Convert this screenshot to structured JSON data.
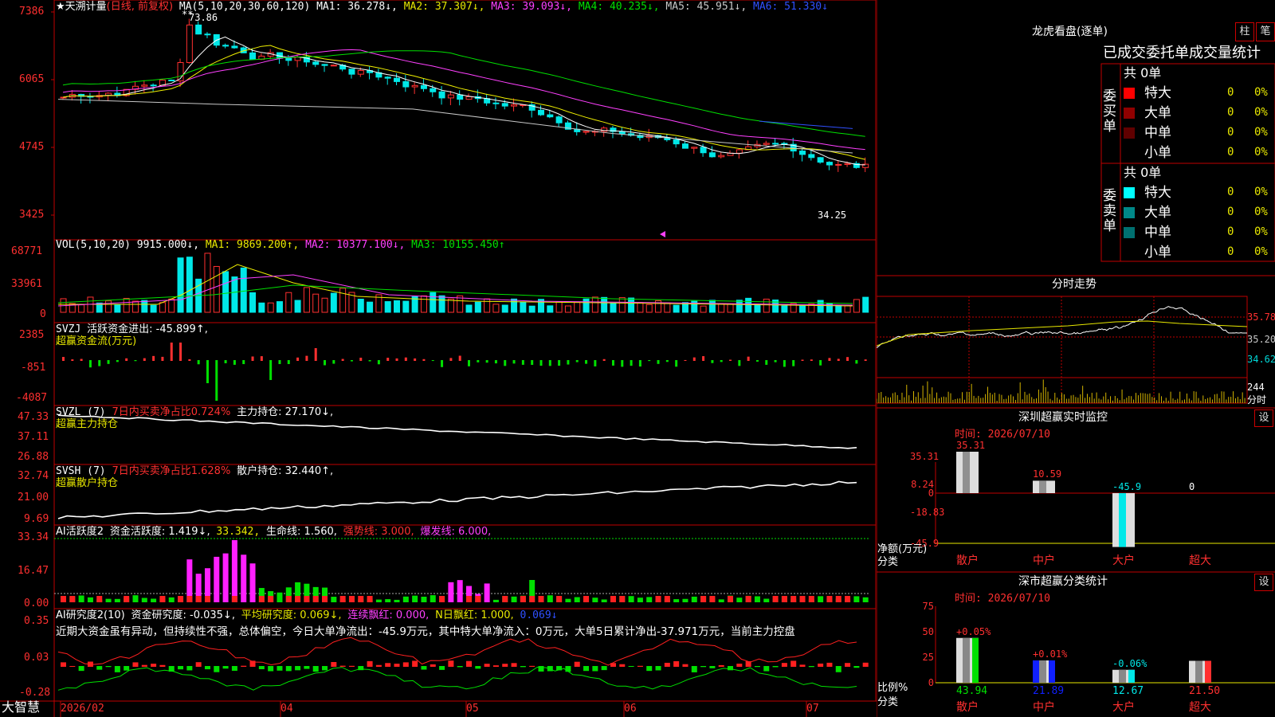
{
  "colors": {
    "up": "#ff3030",
    "down": "#00e8e8",
    "grid": "#c00000",
    "ma1": "#ffffff",
    "ma2": "#f0f000",
    "ma3": "#ff40ff",
    "ma4": "#00e000",
    "ma5": "#c8c8c8",
    "ma6": "#3050ff"
  },
  "main": {
    "title": "★天溯计量",
    "period": "(日线, 前复权)",
    "ma_header": "MA(5,10,20,30,60,120)",
    "ma1": "MA1: 36.278↓,",
    "ma2": "MA2: 37.307↓,",
    "ma3": "MA3: 39.093↓,",
    "ma4": "MA4: 40.235↓,",
    "ma5": "MA5: 45.951↓,",
    "ma6": "MA6: 51.330↓",
    "y_ticks": [
      "7386",
      "6065",
      "4745",
      "3425"
    ],
    "high_label": "73.86",
    "low_label": "34.25"
  },
  "vol": {
    "header": "VOL(5,10,20)",
    "value": "9915.000↓,",
    "ma1": "MA1: 9869.200↑,",
    "ma2": "MA2: 10377.100↓,",
    "ma3": "MA3: 10155.450↑",
    "y_ticks": [
      "68771",
      "33961",
      "0"
    ]
  },
  "svzj": {
    "header": "SVZJ",
    "label": "活跃资金进出: -45.899↑,",
    "sub": "超赢资金流(万元)",
    "y_ticks": [
      "2385",
      "-851",
      "-4087"
    ]
  },
  "svzl": {
    "header": "SVZL (7)",
    "a": "7日内买卖净占比0.724%",
    "b": "主力持仓: 27.170↓,",
    "sub": "超赢主力持仓",
    "y_ticks": [
      "47.33",
      "37.11",
      "26.88"
    ]
  },
  "svsh": {
    "header": "SVSH (7)",
    "a": "7日内买卖净占比1.628%",
    "b": "散户持仓: 32.440↑,",
    "sub": "超赢散户持仓",
    "y_ticks": [
      "32.74",
      "21.00",
      "9.69"
    ]
  },
  "ai2": {
    "header": "AI活跃度2",
    "a": "资金活跃度: 1.419↓,",
    "b": "33.342,",
    "c": "生命线: 1.560,",
    "d": "强势线: 3.000,",
    "e": "爆发线: 6.000,",
    "y_ticks": [
      "33.34",
      "16.47",
      "0.00"
    ]
  },
  "ai_r": {
    "header": "AI研究度2(10)",
    "a": "资金研究度: -0.035↓,",
    "b": "平均研究度: 0.069↓,",
    "c": "连续飘红: 0.000,",
    "d": "N日飘红: 1.000,",
    "e": "0.069↓",
    "comment": "近期大资金虽有异动，但持续性不强，总体偏空，今日大单净流出：-45.9万元，其中特大单净流入：0万元，大单5日累计净出-37.971万元，当前主力控盘",
    "y_ticks": [
      "0.35",
      "0.03",
      "-0.28"
    ]
  },
  "xaxis": {
    "brand": "大智慧",
    "labels": [
      "2026/02",
      "04",
      "05",
      "06",
      "07"
    ]
  },
  "dragon": {
    "title": "龙虎看盘(逐单)",
    "btn1": "柱",
    "btn2": "笔",
    "subtitle": "已成交委托单成交量统计",
    "buy": {
      "side": "委买单",
      "total": "共 0单",
      "rows": [
        {
          "name": "特大",
          "qty": "0",
          "pct": "0%",
          "color": "#ff0000"
        },
        {
          "name": "大单",
          "qty": "0",
          "pct": "0%",
          "color": "#900000"
        },
        {
          "name": "中单",
          "qty": "0",
          "pct": "0%",
          "color": "#600000"
        },
        {
          "name": "小单",
          "qty": "0",
          "pct": "0%",
          "color": ""
        }
      ]
    },
    "sell": {
      "side": "委卖单",
      "total": "共 0单",
      "rows": [
        {
          "name": "特大",
          "qty": "0",
          "pct": "0%",
          "color": "#00ffff"
        },
        {
          "name": "大单",
          "qty": "0",
          "pct": "0%",
          "color": "#008888"
        },
        {
          "name": "中单",
          "qty": "0",
          "pct": "0%",
          "color": "#007070"
        },
        {
          "name": "小单",
          "qty": "0",
          "pct": "0%",
          "color": ""
        }
      ]
    }
  },
  "intraday": {
    "title": "分时走势",
    "prices": [
      "35.78",
      "35.20",
      "34.62"
    ],
    "vol": "244",
    "unit": "分时"
  },
  "sz_monitor": {
    "title": "深圳超赢实时监控",
    "btn": "设",
    "time": "时间: 2026/07/10",
    "y_ticks": [
      "35.31",
      "8.24",
      "0",
      "-18.83",
      "-45.9"
    ],
    "ylabel": "净额(万元)",
    "xtitle": "分类",
    "cats": [
      {
        "name": "散户",
        "value": 35.31,
        "label": "35.31"
      },
      {
        "name": "中户",
        "value": 10.59,
        "label": "10.59"
      },
      {
        "name": "大户",
        "value": -45.9,
        "label": "-45.9"
      },
      {
        "name": "超大",
        "value": 0,
        "label": "0"
      }
    ]
  },
  "sz_class": {
    "title": "深市超赢分类统计",
    "btn": "设",
    "time": "时间: 2026/07/10",
    "y_ticks": [
      "75",
      "50",
      "25",
      "0"
    ],
    "ylabel": "比例%",
    "xtitle": "分类",
    "cats": [
      {
        "name": "散户",
        "value": 43.94,
        "label": "43.94",
        "delta": "+0.05%",
        "color": "#00e000"
      },
      {
        "name": "中户",
        "value": 21.89,
        "label": "21.89",
        "delta": "+0.01%",
        "color": "#1020ff"
      },
      {
        "name": "大户",
        "value": 12.67,
        "label": "12.67",
        "delta": "-0.06%",
        "color": "#00e8e8"
      },
      {
        "name": "超大",
        "value": 21.5,
        "label": "21.50",
        "delta": "",
        "color": "#ff3030"
      }
    ]
  }
}
